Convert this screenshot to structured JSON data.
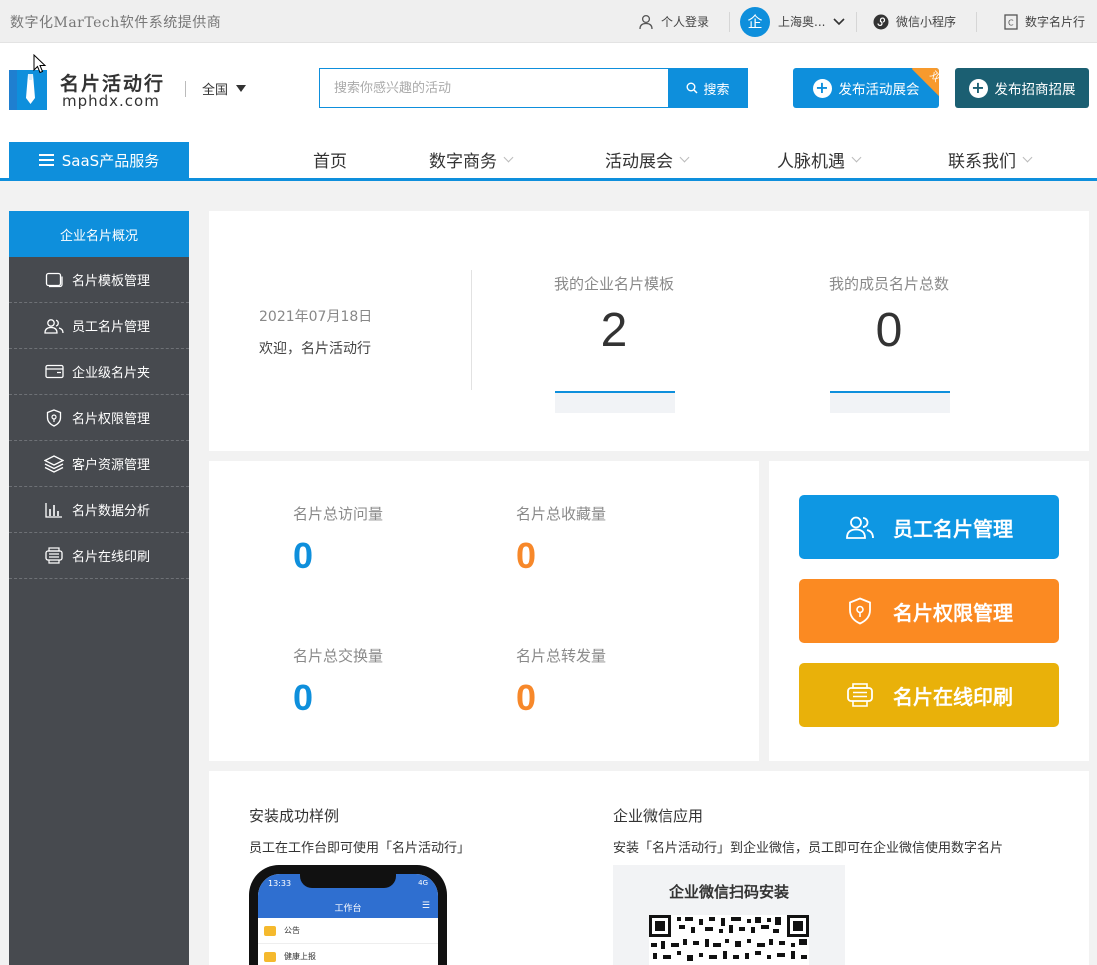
{
  "topbar": {
    "slogan": "数字化MarTech软件系统提供商",
    "login_label": "个人登录",
    "company_badge": "企",
    "company_name": "上海奥...",
    "miniprogram_label": "微信小程序",
    "card_label": "数字名片行"
  },
  "header": {
    "logo_title": "名片活动行",
    "logo_sub": "mphdx.com",
    "region": "全国",
    "search_placeholder": "搜索你感兴趣的活动",
    "search_button": "搜索",
    "publish_activity": "发布活动展会",
    "publish_ribbon": "双",
    "publish_invest": "发布招商招展"
  },
  "nav": {
    "saas_tab": "SaaS产品服务",
    "items": [
      "首页",
      "数字商务",
      "活动展会",
      "人脉机遇",
      "联系我们"
    ]
  },
  "sidebar": {
    "items": [
      {
        "label": "企业名片概况",
        "icon": "overview"
      },
      {
        "label": "名片模板管理",
        "icon": "template-icon"
      },
      {
        "label": "员工名片管理",
        "icon": "users-icon"
      },
      {
        "label": "企业级名片夹",
        "icon": "wallet-icon"
      },
      {
        "label": "名片权限管理",
        "icon": "shield-icon"
      },
      {
        "label": "客户资源管理",
        "icon": "layers-icon"
      },
      {
        "label": "名片数据分析",
        "icon": "bar-chart-icon"
      },
      {
        "label": "名片在线印刷",
        "icon": "printer-icon"
      }
    ]
  },
  "overview": {
    "date": "2021年07月18日",
    "welcome": "欢迎，名片活动行",
    "template_label": "我的企业名片模板",
    "template_count": "2",
    "member_label": "我的成员名片总数",
    "member_count": "0"
  },
  "kpis": {
    "visits_label": "名片总访问量",
    "visits_value": "0",
    "favorites_label": "名片总收藏量",
    "favorites_value": "0",
    "exchanges_label": "名片总交换量",
    "exchanges_value": "0",
    "shares_label": "名片总转发量",
    "shares_value": "0",
    "blue": "#0e8fdc",
    "orange": "#f7882a"
  },
  "quick_actions": {
    "employee": "员工名片管理",
    "permission": "名片权限管理",
    "print": "名片在线印刷",
    "employee_color": "#0e97e3",
    "permission_color": "#fb8a22",
    "print_color": "#e9b10a"
  },
  "install": {
    "example_title": "安装成功样例",
    "example_desc": "员工在工作台即可使用「名片活动行」",
    "wecom_title": "企业微信应用",
    "wecom_desc": "安装「名片活动行」到企业微信，员工即可在企业微信使用数字名片",
    "qr_title": "企业微信扫码安装",
    "phone_time": "13:33",
    "phone_signal": "4G",
    "phone_title": "工作台",
    "phone_row1": "公告",
    "phone_row2": "健康上报"
  }
}
